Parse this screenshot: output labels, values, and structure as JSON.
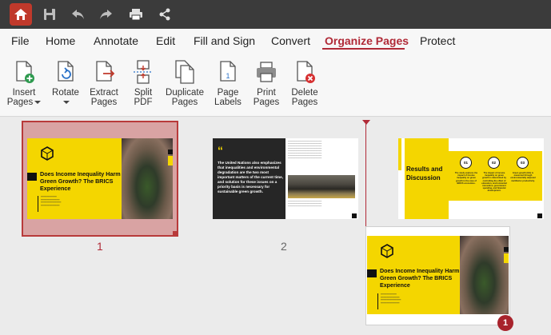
{
  "titlebar": {
    "icons": [
      "home-icon",
      "save-icon",
      "undo-icon",
      "redo-icon",
      "print-icon",
      "share-icon"
    ]
  },
  "menu": {
    "items": [
      "File",
      "Home",
      "Annotate",
      "Edit",
      "Fill and Sign",
      "Convert",
      "Organize Pages",
      "Protect"
    ],
    "active": "Organize Pages"
  },
  "ribbon": {
    "insert": [
      "Insert",
      "Pages"
    ],
    "rotate": [
      "Rotate"
    ],
    "extract": [
      "Extract",
      "Pages"
    ],
    "split": [
      "Split",
      "PDF"
    ],
    "duplicate": [
      "Duplicate",
      "Pages"
    ],
    "labels": [
      "Page",
      "Labels"
    ],
    "print": [
      "Print",
      "Pages"
    ],
    "delete": [
      "Delete",
      "Pages"
    ],
    "labels_icon_number": "1"
  },
  "pages": {
    "p1": {
      "number": "1",
      "title": "Does Income Inequality Harm Green Growth? The BRICS Experience"
    },
    "p2": {
      "number": "2",
      "quote": "The United Nations also emphasizes that inequalities and environmental degradation are the two most important matters of the current time, and solution for these issues on a priority basis is necessary for sustainable green growth."
    },
    "p3": {
      "title": "Results and Discussion",
      "steps": [
        "01",
        "02",
        "03"
      ],
      "descriptions": [
        "The study explores the impact of income inequality on green growth in the case of BRICS economies.",
        "The impact of income inequality on green growth is determined by controlling the effect of education, environmental innovation, government spending, and financial development.",
        "Green growth (GG) is measured through environmentally adjusted multifactor productivity."
      ]
    },
    "dragged": {
      "title": "Does Income Inequality Harm Green Growth? The BRICS Experience",
      "badge": "1"
    }
  },
  "colors": {
    "accent": "#b02a37",
    "slide_yellow": "#f4d600",
    "titlebar": "#3b3b3b"
  }
}
